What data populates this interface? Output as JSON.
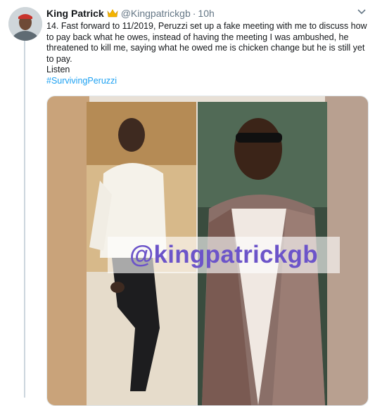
{
  "tweet": {
    "display_name": "King Patrick",
    "crown_emoji": "👑",
    "handle": "@Kingpatrickgb",
    "separator": "·",
    "time": "10h",
    "text_main": "14. Fast forward to 11/2019, Peruzzi set up a fake meeting with me to discuss how to pay back what he owes, instead of having the meeting I was ambushed, he threatened to kill me, saying what he owed me is chicken change but he is still yet to pay.",
    "text_listen": "Listen",
    "hashtag": "#SurvivingPeruzzi"
  },
  "media": {
    "watermark": "@kingpatrickgb"
  },
  "icons": {
    "avatar": "avatar-photo",
    "crown": "crown-icon",
    "menu": "chevron-down-icon"
  },
  "colors": {
    "link": "#1da1f2",
    "secondary_text": "#657786",
    "watermark": "#6c54c9"
  }
}
